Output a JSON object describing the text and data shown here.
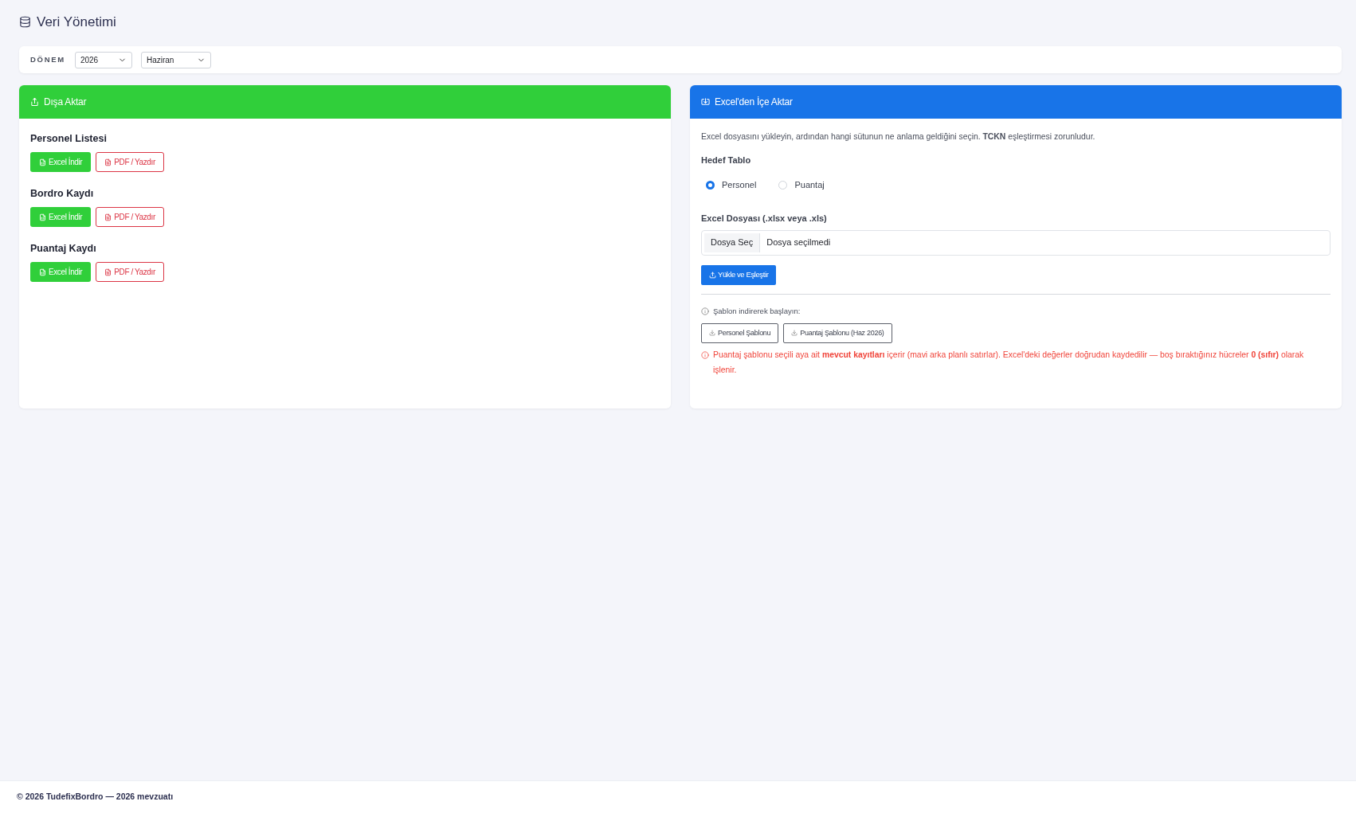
{
  "page": {
    "title": "Veri Yönetimi"
  },
  "period": {
    "label": "DÖNEM",
    "selects": [
      {
        "value": "2026"
      },
      {
        "value": "Haziran"
      }
    ]
  },
  "export_card": {
    "title": "Dışa Aktar",
    "sections": [
      {
        "title": "Personel Listesi",
        "buttons": [
          {
            "kind": "excel",
            "label": "Excel İndir"
          },
          {
            "kind": "pdf",
            "label": "PDF / Yazdır"
          }
        ]
      },
      {
        "title": "Bordro Kaydı",
        "buttons": [
          {
            "kind": "excel",
            "label": "Excel İndir"
          },
          {
            "kind": "pdf",
            "label": "PDF / Yazdır"
          }
        ]
      },
      {
        "title": "Puantaj Kaydı",
        "buttons": [
          {
            "kind": "excel",
            "label": "Excel İndir"
          },
          {
            "kind": "pdf",
            "label": "PDF / Yazdır"
          }
        ]
      }
    ]
  },
  "import_card": {
    "title": "Excel'den İçe Aktar",
    "description": "Excel dosyasını yükleyin, ardından hangi sütunun ne anlama geldiğini seçin. **TCKN** eşleştirmesi zorunludur.",
    "target_label": "Hedef Tablo",
    "targets": [
      {
        "label": "Personel",
        "selected": true
      },
      {
        "label": "Puantaj",
        "selected": false
      }
    ],
    "file_label": "Excel Dosyası (.xlsx veya .xls)",
    "file_input": {
      "button": "Dosya Seç",
      "value": "Dosya seçilmedi"
    },
    "upload_button": "Yükle ve Eşleştir",
    "template_hint": "Şablon indirerek başlayın:",
    "template_buttons": [
      "Personel Şablonu",
      "Puantaj Şablonu (Haz 2026)"
    ],
    "warning": "Puantaj şablonu seçili aya ait **mevcut kayıtları** içerir (mavi arka planlı satırlar). Excel'deki değerler doğrudan kaydedilir — boş bıraktığınız hücreler **0 (sıfır)** olarak işlenir."
  },
  "footer": {
    "text": "© 2026 **TudefixBordro** — 2026 mevzuatı"
  }
}
